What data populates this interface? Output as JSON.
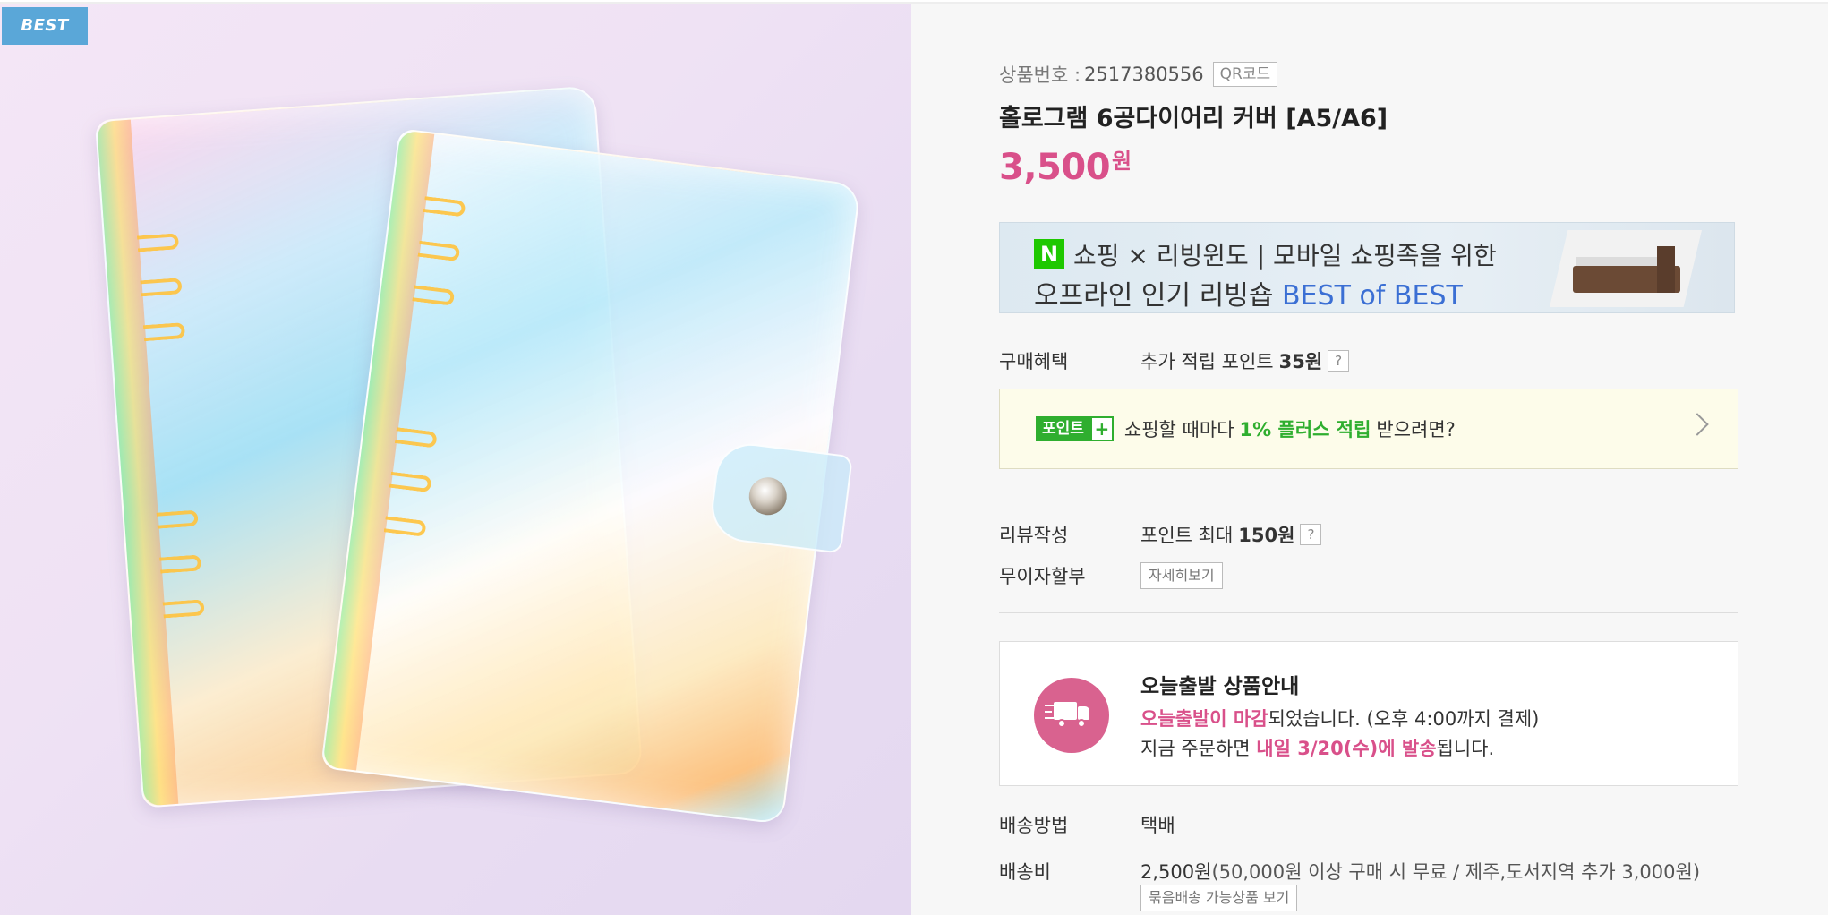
{
  "badge": {
    "best": "BEST"
  },
  "product": {
    "code_label": "상품번호 :",
    "code_value": "2517380556",
    "qr_button": "QR코드",
    "title": "홀로그램 6공다이어리 커버 [A5/A6]",
    "price_number": "3,500",
    "price_unit": "원"
  },
  "banner": {
    "logo": "N",
    "line1": "쇼핑 × 리빙윈도 | 모바일 쇼핑족을 위한",
    "line2_prefix": "오프라인 인기 리빙숍 ",
    "line2_highlight": "BEST of BEST"
  },
  "benefit": {
    "label": "구매혜택",
    "text": "추가 적립 포인트",
    "amount": "35원",
    "help": "?"
  },
  "point_promo": {
    "badge_text": "포인트",
    "badge_plus": "+",
    "text_before": "쇼핑할 때마다",
    "highlight": "1% 플러스 적립",
    "text_after": "받으려면?"
  },
  "review": {
    "label": "리뷰작성",
    "text": "포인트 최대",
    "amount": "150원",
    "help": "?"
  },
  "installment": {
    "label": "무이자할부",
    "button": "자세히보기"
  },
  "same_day": {
    "title": "오늘출발 상품안내",
    "line1_highlight": "오늘출발이 마감",
    "line1_rest": "되었습니다. (오후 4:00까지 결제)",
    "line2_before": "지금 주문하면 ",
    "line2_highlight": "내일 3/20(수)에 발송",
    "line2_after": "됩니다."
  },
  "delivery_method": {
    "label": "배송방법",
    "value": "택배"
  },
  "delivery_fee": {
    "label": "배송비",
    "amount": "2,500원",
    "note": " (50,000원 이상 구매 시 무료 / 제주,도서지역 추가 3,000원)",
    "bundle_button": "묶음배송 가능상품 보기"
  },
  "colors": {
    "price_pink": "#d9508a",
    "point_green": "#2fae2f",
    "best_badge_blue": "#5aa7d8"
  }
}
